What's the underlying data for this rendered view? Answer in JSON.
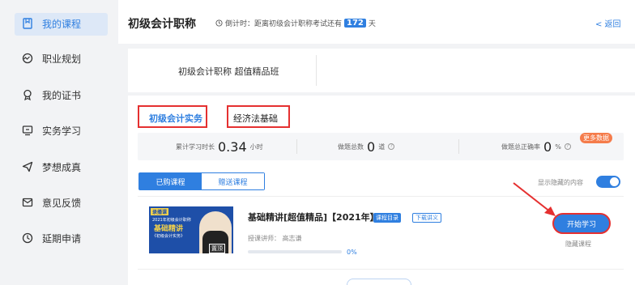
{
  "sidebar": {
    "items": [
      {
        "label": "我的课程",
        "icon": "bookmark-icon",
        "active": true
      },
      {
        "label": "职业规划",
        "icon": "dashboard-icon",
        "active": false
      },
      {
        "label": "我的证书",
        "icon": "certificate-icon",
        "active": false
      },
      {
        "label": "实务学习",
        "icon": "monitor-icon",
        "active": false
      },
      {
        "label": "梦想成真",
        "icon": "send-icon",
        "active": false
      },
      {
        "label": "意见反馈",
        "icon": "mail-icon",
        "active": false
      },
      {
        "label": "延期申请",
        "icon": "clock-icon",
        "active": false
      }
    ]
  },
  "header": {
    "title": "初级会计职称",
    "countdown_prefix": "倒计时：距离初级会计职称考试还有",
    "countdown_days": "172",
    "countdown_suffix": "天",
    "back_label": "< 返回"
  },
  "class_name": "初级会计职称 超值精品班",
  "tabs": [
    {
      "label": "初级会计实务",
      "active": true
    },
    {
      "label": "经济法基础",
      "active": false
    }
  ],
  "stats": {
    "study_time_label": "累计学习时长",
    "study_time_value": "0.34",
    "study_time_unit": "小时",
    "questions_label": "做题总数",
    "questions_value": "0",
    "questions_unit": "道",
    "accuracy_label": "做题总正确率",
    "accuracy_value": "0",
    "accuracy_unit": "%",
    "more_label": "更多数据"
  },
  "segment": {
    "purchased": "已购课程",
    "gifted": "赠送课程"
  },
  "show_hidden_label": "显示隐藏的内容",
  "course": {
    "title": "基础精讲[超值精品]【2021年】",
    "catalog_badge": "课程目录",
    "download_badge": "下载讲义",
    "teacher_label": "授课讲师：",
    "teacher_name": "高志谦",
    "progress_text": "0%",
    "progress": 0,
    "start_label": "开始学习",
    "hide_label": "隐藏课程",
    "thumb": {
      "tag": "录播课",
      "line1": "2021年初级会计职称",
      "line2": "基础精讲",
      "line3": "《初级会计实务》",
      "badge": "置顶"
    }
  },
  "colors": {
    "accent": "#2f7fe0",
    "highlight": "#e53030",
    "orange": "#f57c4b"
  }
}
